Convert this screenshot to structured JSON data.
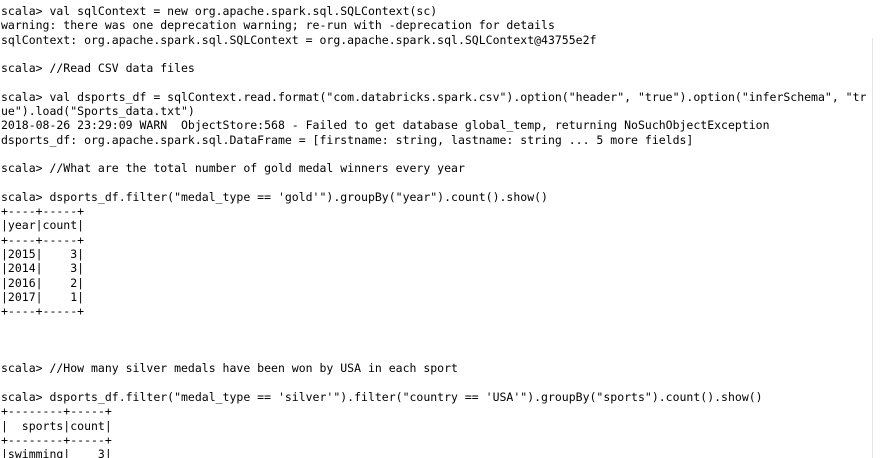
{
  "terminal": {
    "lines": [
      "scala> val sqlContext = new org.apache.spark.sql.SQLContext(sc)",
      "warning: there was one deprecation warning; re-run with -deprecation for details",
      "sqlContext: org.apache.spark.sql.SQLContext = org.apache.spark.sql.SQLContext@43755e2f",
      "",
      "scala> //Read CSV data files",
      "",
      "scala> val dsports_df = sqlContext.read.format(\"com.databricks.spark.csv\").option(\"header\", \"true\").option(\"inferSchema\", \"tr",
      "ue\").load(\"Sports_data.txt\")",
      "2018-08-26 23:29:09 WARN  ObjectStore:568 - Failed to get database global_temp, returning NoSuchObjectException",
      "dsports_df: org.apache.spark.sql.DataFrame = [firstname: string, lastname: string ... 5 more fields]",
      "",
      "scala> //What are the total number of gold medal winners every year",
      "",
      "scala> dsports_df.filter(\"medal_type == 'gold'\").groupBy(\"year\").count().show()",
      "+----+-----+",
      "|year|count|",
      "+----+-----+",
      "|2015|    3|",
      "|2014|    3|",
      "|2016|    2|",
      "|2017|    1|",
      "+----+-----+",
      "",
      "",
      "",
      "scala> //How many silver medals have been won by USA in each sport",
      "",
      "scala> dsports_df.filter(\"medal_type == 'silver'\").filter(\"country == 'USA'\").groupBy(\"sports\").count().show()",
      "+--------+-----+",
      "|  sports|count|",
      "+--------+-----+",
      "|swimming|    3|",
      "+--------+-----+"
    ]
  }
}
